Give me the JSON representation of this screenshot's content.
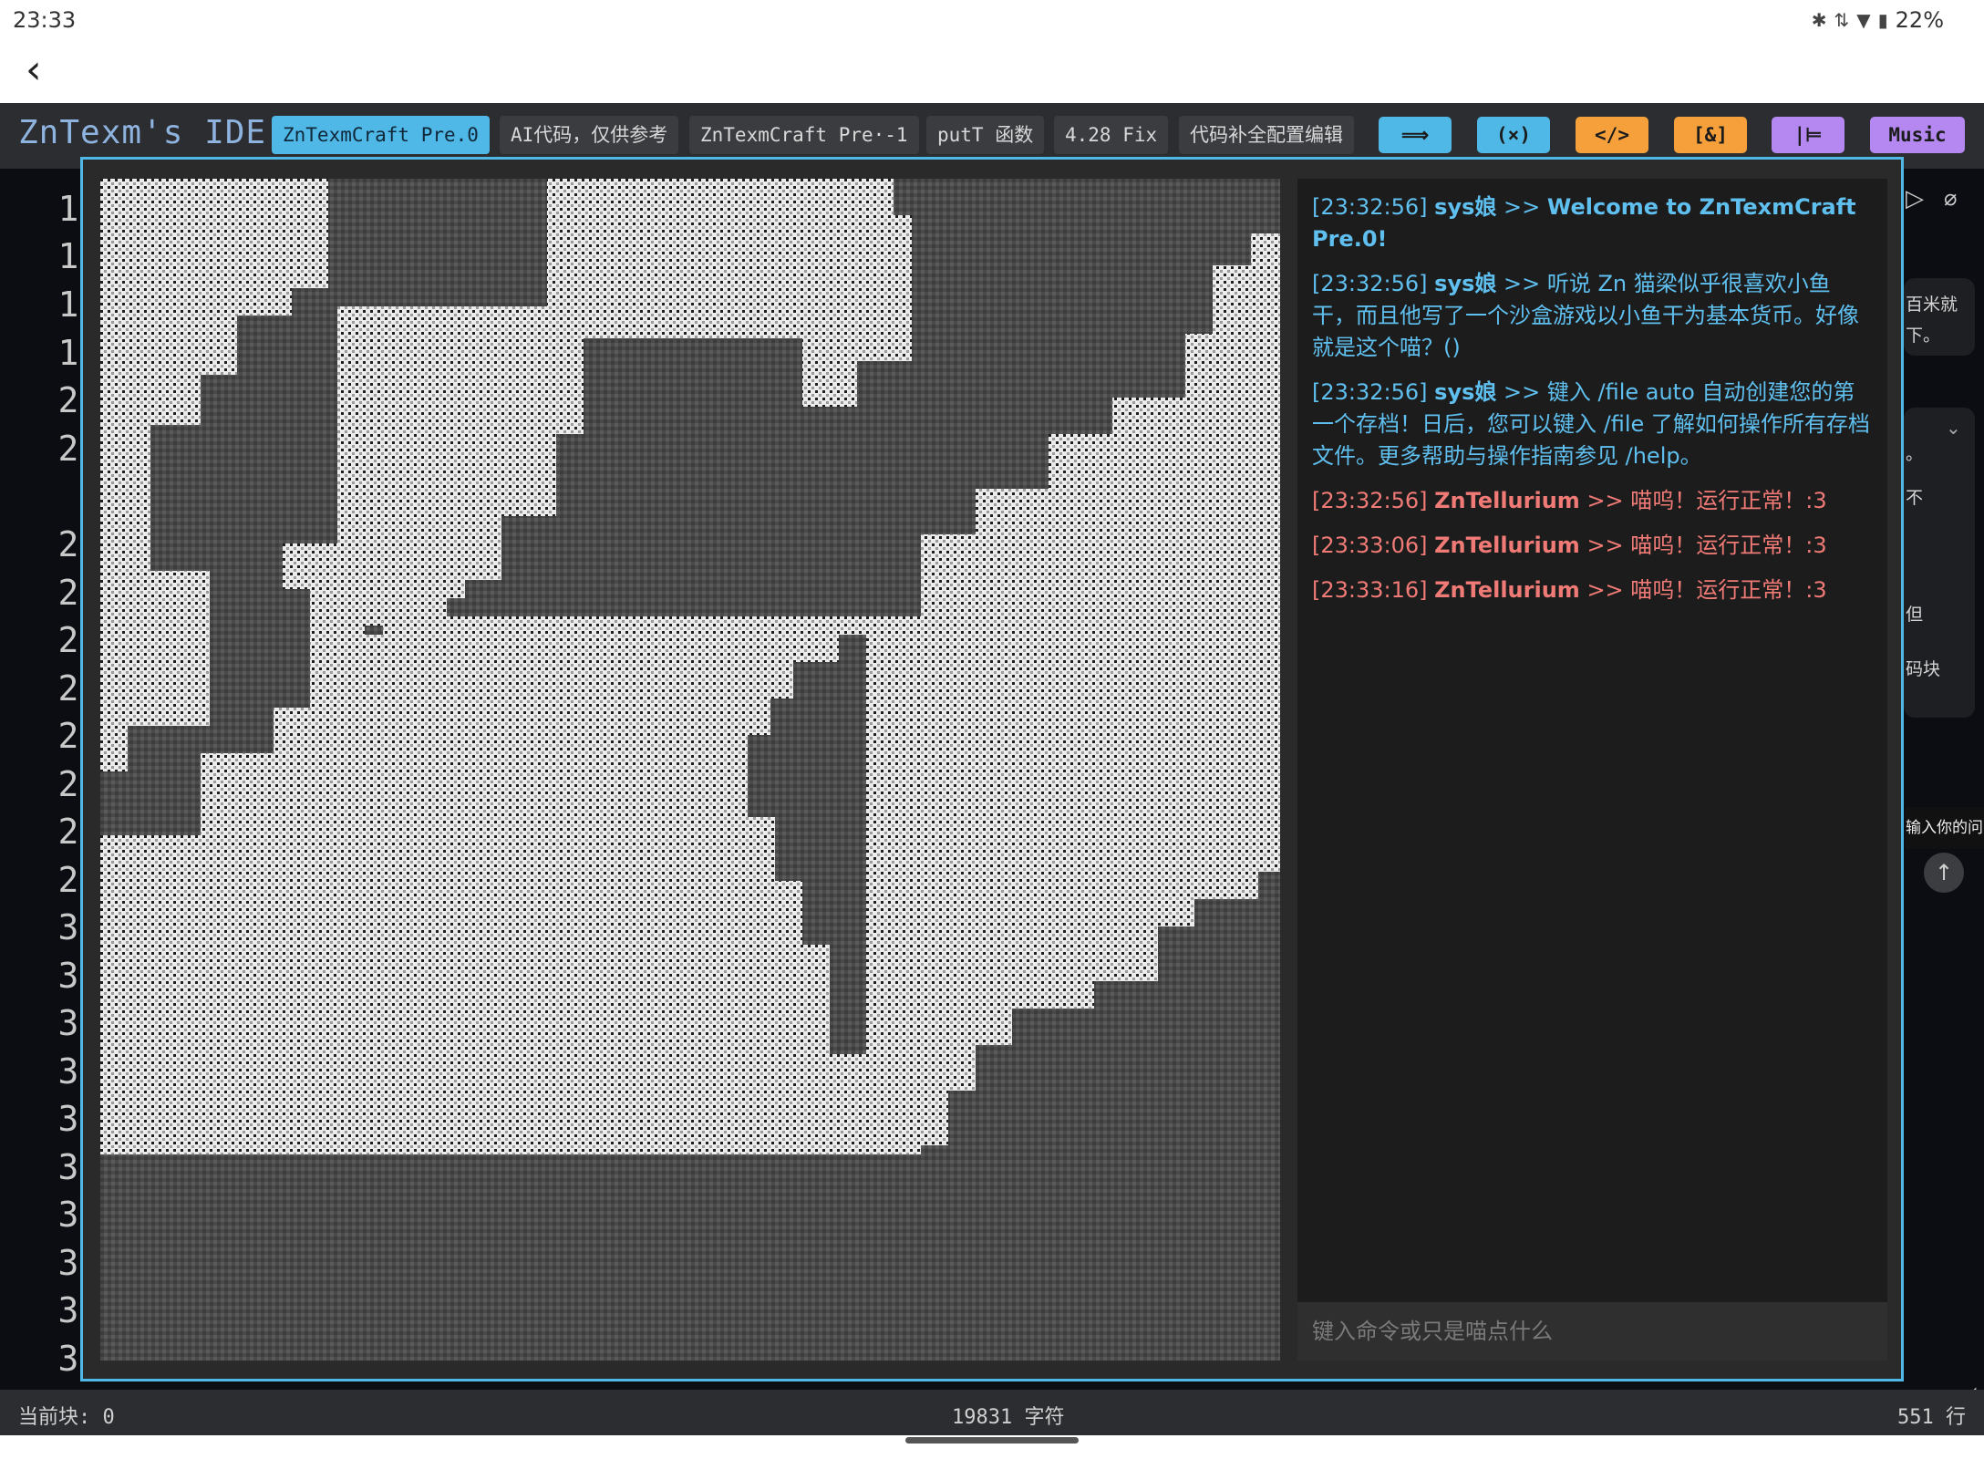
{
  "status_bar": {
    "time": "23:33",
    "battery": "22%",
    "icons": [
      "bluetooth-icon",
      "data-arrows-icon",
      "wifi-icon",
      "battery-icon"
    ]
  },
  "app_bar": {
    "back_icon": "back-arrow-icon"
  },
  "ide": {
    "title": "ZnTexm's IDE",
    "tabs": [
      {
        "label": "ZnTexmCraft Pre.0",
        "active": true
      },
      {
        "label": "AI代码，仅供参考",
        "active": false
      },
      {
        "label": "ZnTexmCraft Pre·-1",
        "active": false
      },
      {
        "label": "putT 函数",
        "active": false
      },
      {
        "label": "4.28 Fix",
        "active": false
      },
      {
        "label": "代码补全配置编辑",
        "active": false
      }
    ],
    "tool_buttons": [
      {
        "label": "⟹",
        "color": "#4fb8e6"
      },
      {
        "label": "(×)",
        "color": "#4fb8e6"
      },
      {
        "label": "</>",
        "color": "#f5a03a"
      },
      {
        "label": "[&]",
        "color": "#f5a03a"
      },
      {
        "label": "|⊨",
        "color": "#b488f0"
      },
      {
        "label": "Music",
        "color": "#b488f0"
      }
    ],
    "line_numbers": [
      "1",
      "1",
      "1",
      "1",
      "2",
      "2",
      "2",
      "2",
      "2",
      "2",
      "2",
      "2",
      "2",
      "2",
      "3",
      "3",
      "3",
      "3",
      "3",
      "3",
      "3",
      "3",
      "3",
      "3"
    ]
  },
  "right_panel": {
    "snippet_1": "百米就",
    "snippet_2": "下。",
    "snippet_3": "。",
    "snippet_4": "不",
    "snippet_5": "但",
    "snippet_6": "码块",
    "input_tip": "输入你的问",
    "icons": [
      "play-icon",
      "attachment-icon",
      "chevron-down-icon",
      "arrow-up-icon",
      "chevron-left-icon"
    ]
  },
  "game": {
    "chat": [
      {
        "time": "[23:32:56]",
        "who": "sys娘",
        "sep": " >> ",
        "text": "Welcome to ZnTexmCraft Pre.0!",
        "kind": "sys",
        "highlight": true
      },
      {
        "time": "[23:32:56]",
        "who": "sys娘",
        "sep": " >> ",
        "text": "听说 Zn 猫梁似乎很喜欢小鱼干，而且他写了一个沙盒游戏以小鱼干为基本货币。好像就是这个喵？()",
        "kind": "sys",
        "highlight": false
      },
      {
        "time": "[23:32:56]",
        "who": "sys娘",
        "sep": " >> ",
        "text": "键入 /file auto 自动创建您的第一个存档！日后，您可以键入 /file 了解如何操作所有存档文件。更多帮助与操作指南参见 /help。",
        "kind": "sys",
        "highlight": false
      },
      {
        "time": "[23:32:56]",
        "who": "ZnTellurium",
        "sep": " >> ",
        "text": "喵呜！运行正常！:3",
        "kind": "zn",
        "highlight": false
      },
      {
        "time": "[23:33:06]",
        "who": "ZnTellurium",
        "sep": " >> ",
        "text": "喵呜！运行正常！:3",
        "kind": "zn",
        "highlight": false
      },
      {
        "time": "[23:33:16]",
        "who": "ZnTellurium",
        "sep": " >> ",
        "text": "喵呜！运行正常！:3",
        "kind": "zn",
        "highlight": false
      }
    ],
    "input_placeholder": "键入命令或只是喵点什么"
  },
  "footer": {
    "current_block": "当前块: 0",
    "chars": "19831 字符",
    "lines": "551 行"
  },
  "colors": {
    "accent_blue": "#4fb8e6",
    "sys_message": "#5fbfef",
    "zn_message": "#f07a76"
  }
}
